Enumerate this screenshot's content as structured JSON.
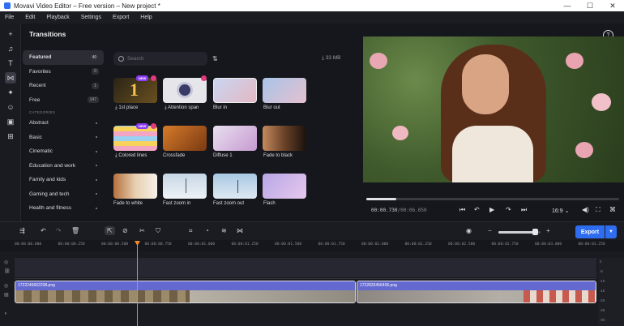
{
  "window": {
    "title": "Movavi Video Editor – Free version – New project *",
    "minimize": "—",
    "maximize": "☐",
    "close": "✕"
  },
  "menu": [
    "File",
    "Edit",
    "Playback",
    "Settings",
    "Export",
    "Help"
  ],
  "panel": {
    "title": "Transitions",
    "categories_top": [
      {
        "label": "Featured",
        "count": "40"
      },
      {
        "label": "Favorites",
        "count": "0"
      },
      {
        "label": "Recent",
        "count": "1"
      },
      {
        "label": "Free",
        "count": "147"
      }
    ],
    "categories_heading": "CATEGORIES",
    "categories": [
      "Abstract",
      "Basic",
      "Cinematic",
      "Education and work",
      "Family and kids",
      "Gaming and tech",
      "Health and fitness"
    ]
  },
  "search": {
    "placeholder": "Search"
  },
  "storage": "33 MB",
  "transitions": [
    {
      "label": "1st place",
      "badge": "NEW",
      "download": true,
      "premium": true
    },
    {
      "label": "Attention span",
      "download": true,
      "premium": true
    },
    {
      "label": "Blur in"
    },
    {
      "label": "Blur out"
    },
    {
      "label": "Colored lines",
      "badge": "NEW",
      "download": true,
      "premium": true
    },
    {
      "label": "Crossfade"
    },
    {
      "label": "Diffuse 1"
    },
    {
      "label": "Fade to black"
    },
    {
      "label": "Fade to white"
    },
    {
      "label": "Fast zoom in"
    },
    {
      "label": "Fast zoom out"
    },
    {
      "label": "Flash"
    }
  ],
  "player": {
    "time_current": "00:00.730",
    "time_total": "/00:06.050",
    "aspect": "16:9",
    "progress": 0.12
  },
  "timeline": {
    "export_label": "Export",
    "zoom_level": 0.85,
    "ruler": [
      "00:00:00.000",
      "00:00:00.250",
      "00:00:00.500",
      "00:00:00.750",
      "00:00:01.000",
      "00:00:01.250",
      "00:00:01.500",
      "00:00:01.750",
      "00:00:02.000",
      "00:00:02.250",
      "00:00:02.500",
      "00:00:02.750",
      "00:00:03.000",
      "00:00:03.250"
    ],
    "clips": [
      "1722246662208.png",
      "1722833456406.png"
    ],
    "meter": [
      "0",
      "-5",
      "-10",
      "-15",
      "-20",
      "-25",
      "-30"
    ]
  },
  "colors": {
    "accent": "#2e6df0",
    "playhead": "#f08a2b",
    "clip": "#5e63c6"
  }
}
